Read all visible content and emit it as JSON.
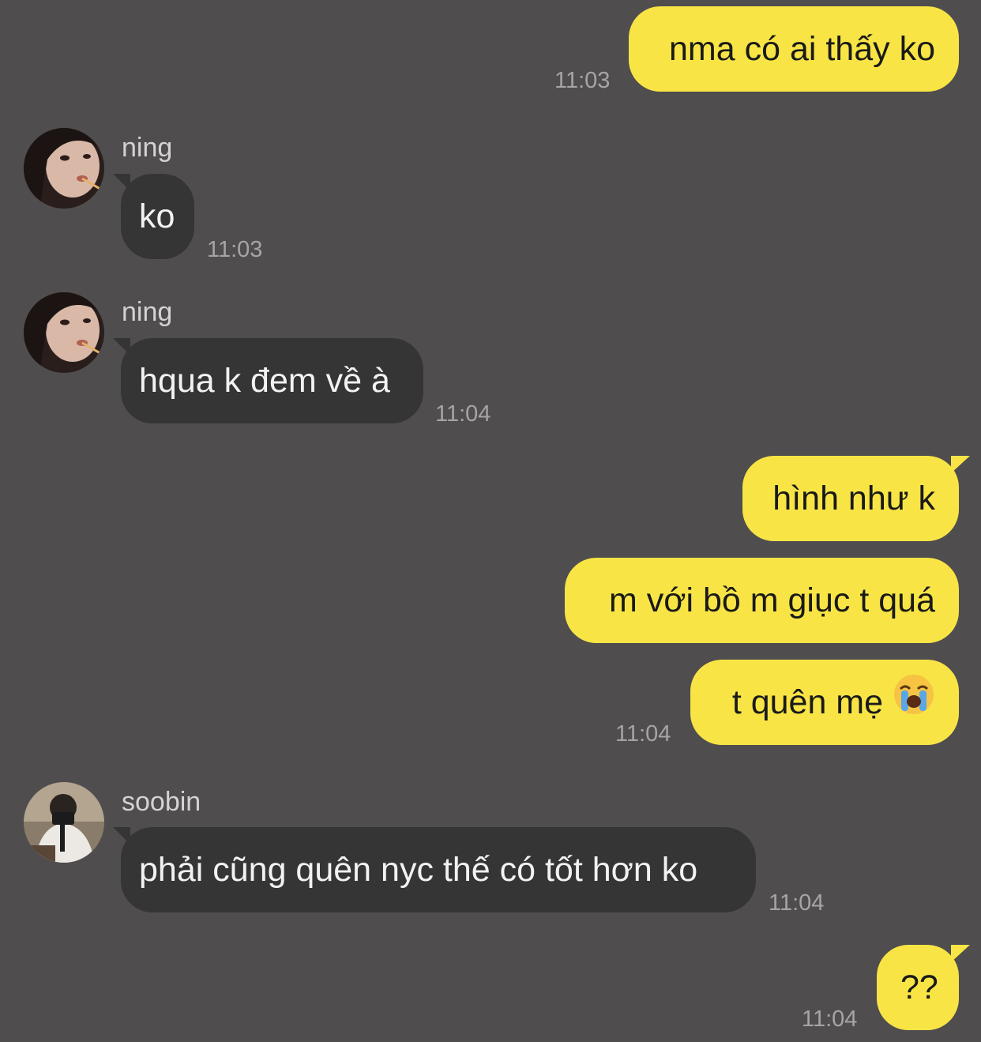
{
  "messages": [
    {
      "sender": "me",
      "text": "nma có ai thấy ko",
      "time": "11:03"
    },
    {
      "sender": "ning",
      "name": "ning",
      "text": "ko",
      "time": "11:03"
    },
    {
      "sender": "ning",
      "name": "ning",
      "text": "hqua k đem về à",
      "time": "11:04"
    },
    {
      "sender": "me",
      "text": "hình như k"
    },
    {
      "sender": "me",
      "text": "m với bồ m giục t quá"
    },
    {
      "sender": "me",
      "text": "t quên mẹ",
      "emoji": "loudly-crying-face",
      "time": "11:04"
    },
    {
      "sender": "soobin",
      "name": "soobin",
      "text": "phải cũng quên nyc thế có tốt hơn ko",
      "time": "11:04"
    },
    {
      "sender": "me",
      "text": "??",
      "time": "11:04"
    }
  ],
  "colors": {
    "background": "#4f4d4e",
    "my_bubble": "#f8e545",
    "their_bubble": "#363536",
    "timestamp": "#a6a4a5"
  }
}
